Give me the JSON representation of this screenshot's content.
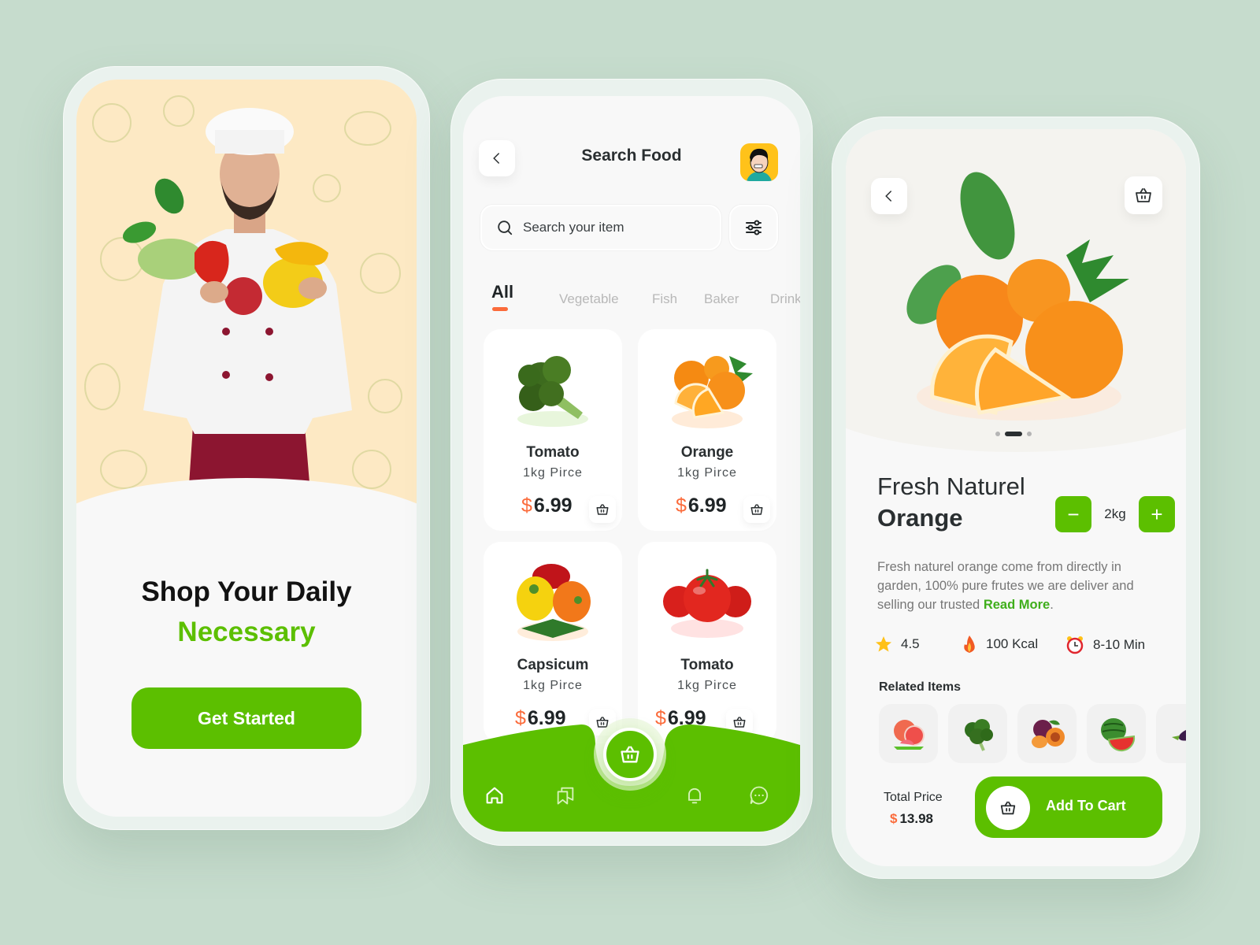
{
  "colors": {
    "background": "#c6dccd",
    "accent_green": "#5cbf00",
    "accent_orange": "#fb6b3b",
    "text_dark": "#2a2f31"
  },
  "onboarding": {
    "hero_image": "chef-holding-vegetables",
    "title_line1": "Shop Your Daily",
    "title_line2": "Necessary",
    "cta_label": "Get Started"
  },
  "search_screen": {
    "header": {
      "back_icon": "chevron-left-icon",
      "title": "Search Food",
      "avatar": "user-avatar"
    },
    "search": {
      "placeholder": "Search your item",
      "value": "",
      "filter_icon": "sliders-icon"
    },
    "tabs": [
      {
        "label": "All",
        "active": true
      },
      {
        "label": "Vegetable",
        "active": false
      },
      {
        "label": "Fish",
        "active": false
      },
      {
        "label": "Baker",
        "active": false
      },
      {
        "label": "Drink",
        "active": false
      }
    ],
    "products": [
      {
        "name": "Tomato",
        "unit": "1kg Pirce",
        "currency": "$",
        "price": "6.99",
        "image": "broccoli"
      },
      {
        "name": "Orange",
        "unit": "1kg Pirce",
        "currency": "$",
        "price": "6.99",
        "image": "oranges"
      },
      {
        "name": "Capsicum",
        "unit": "1kg Pirce",
        "currency": "$",
        "price": "6.99",
        "image": "bell-peppers"
      },
      {
        "name": "Tomato",
        "unit": "1kg Pirce",
        "currency": "$",
        "price": "6.99",
        "image": "tomatoes"
      }
    ],
    "bottom_nav": [
      {
        "icon": "home-icon",
        "label": "Home",
        "active": true
      },
      {
        "icon": "bookmarks-icon",
        "label": "Saved",
        "active": false
      },
      {
        "icon": "basket-icon",
        "label": "Cart",
        "active": false
      },
      {
        "icon": "bell-icon",
        "label": "Notifications",
        "active": false
      },
      {
        "icon": "chat-icon",
        "label": "Messages",
        "active": false
      }
    ]
  },
  "detail_screen": {
    "back_icon": "chevron-left-icon",
    "cart_icon": "basket-icon",
    "carousel": {
      "count": 3,
      "active_index": 1
    },
    "title_line1": "Fresh Naturel",
    "title_line2": "Orange",
    "quantity": {
      "minus": "−",
      "value": "2kg",
      "plus": "+"
    },
    "description": "Fresh naturel orange come from directly in garden, 100% pure frutes we are deliver and selling our trusted",
    "read_more": "Read More",
    "stats": [
      {
        "icon": "star-icon",
        "value": "4.5"
      },
      {
        "icon": "fire-icon",
        "value": "100 Kcal"
      },
      {
        "icon": "alarm-clock-icon",
        "value": "8-10 Min"
      }
    ],
    "related_title": "Related Items",
    "related_items": [
      "grapefruit",
      "kale",
      "plum",
      "watermelon",
      "eggplant"
    ],
    "total_label": "Total Price",
    "total_currency": "$",
    "total_value": "13.98",
    "add_to_cart_label": "Add To Cart"
  }
}
